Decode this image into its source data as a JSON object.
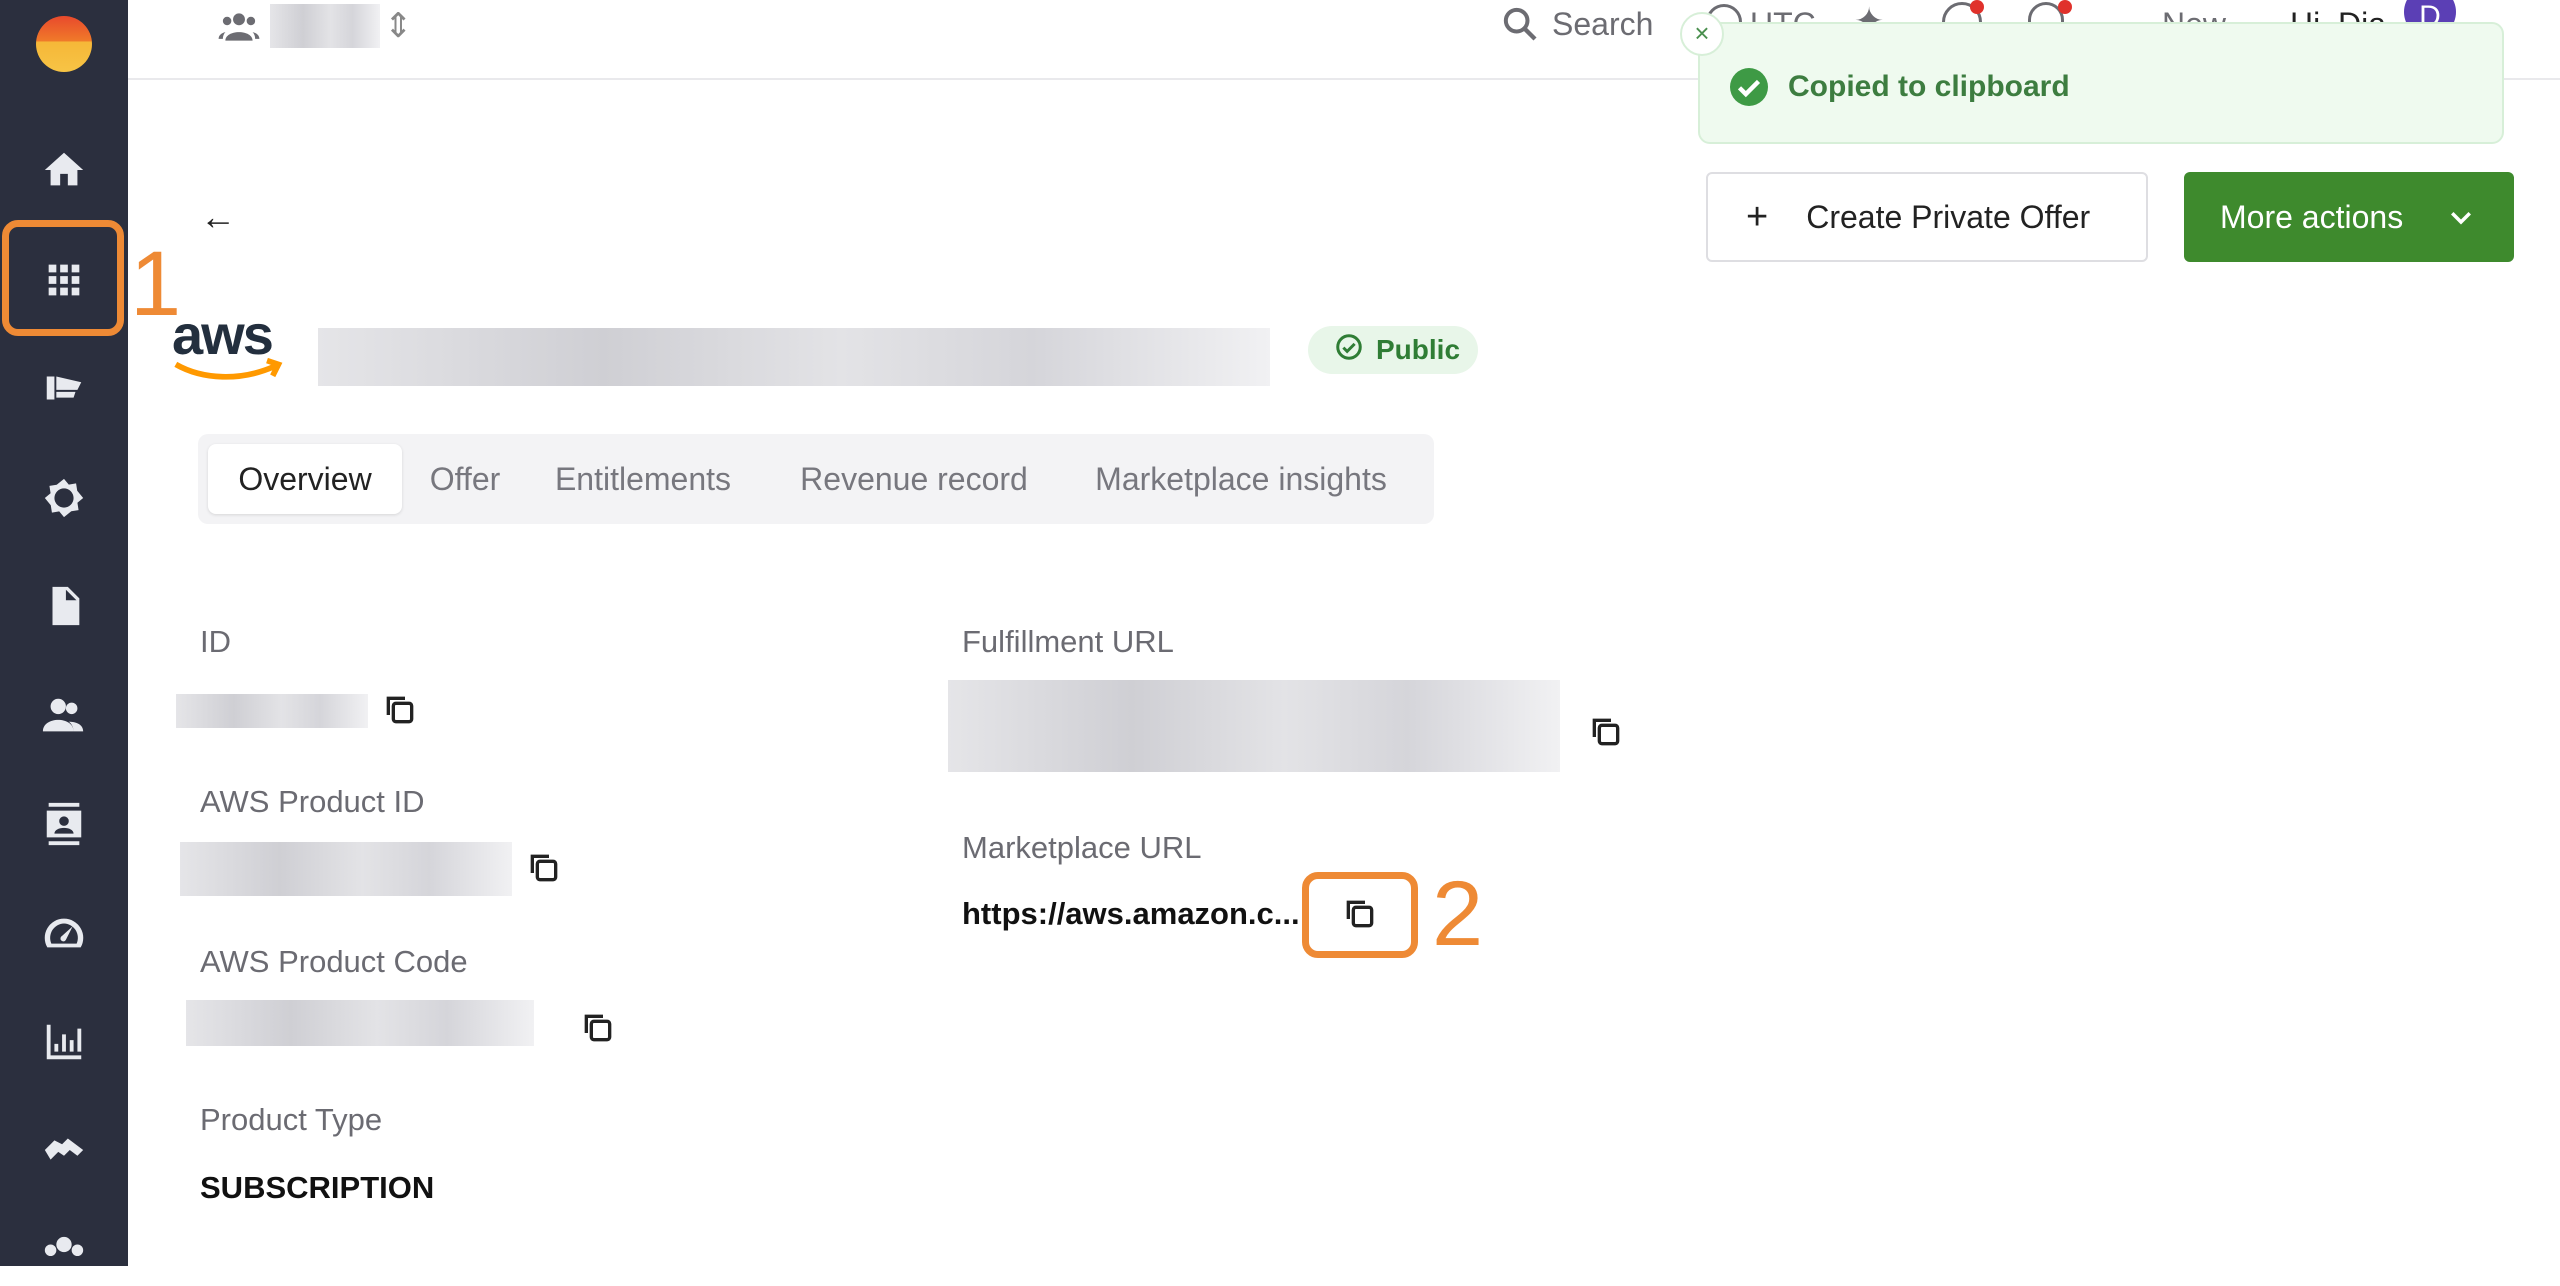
{
  "topbar": {
    "search_label": "Search",
    "utc_label": "UTC",
    "new_label": "New",
    "greeting": "Hi, Dia",
    "avatar_initial": "D"
  },
  "toast": {
    "message": "Copied to clipboard",
    "close_glyph": "×"
  },
  "header": {
    "back_glyph": "←",
    "provider_logo_text": "aws",
    "status_badge": "Public",
    "create_offer_label": "Create Private Offer",
    "more_actions_label": "More actions"
  },
  "tabs": [
    {
      "label": "Overview",
      "active": true
    },
    {
      "label": "Offer",
      "active": false
    },
    {
      "label": "Entitlements",
      "active": false
    },
    {
      "label": "Revenue record",
      "active": false
    },
    {
      "label": "Marketplace insights",
      "active": false
    }
  ],
  "fields": {
    "id_label": "ID",
    "aws_product_id_label": "AWS Product ID",
    "aws_product_code_label": "AWS Product Code",
    "product_type_label": "Product Type",
    "product_type_value": "SUBSCRIPTION",
    "fulfillment_url_label": "Fulfillment URL",
    "marketplace_url_label": "Marketplace URL",
    "marketplace_url_value": "https://aws.amazon.c..."
  },
  "annotations": {
    "step1": "1",
    "step2": "2",
    "color": "#ee8a35"
  },
  "sidebar_icons": [
    "home-icon",
    "apps-grid-icon",
    "listings-icon",
    "settings-icon",
    "document-icon",
    "people-icon",
    "contacts-icon",
    "speedometer-icon",
    "analytics-icon",
    "handshake-icon",
    "team-icon"
  ],
  "colors": {
    "sidebar_bg": "#2b2f3e",
    "primary_green": "#3e8a2d",
    "toast_bg": "#effaef"
  }
}
